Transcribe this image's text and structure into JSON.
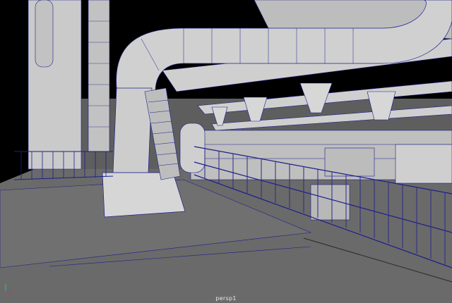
{
  "viewport": {
    "camera_label": "persp1",
    "shading": "wireframe-on-shaded",
    "colors": {
      "background": "#5e5e5e",
      "surface": "#c9c9c9",
      "wire": "#1c1f8a",
      "dark_wall": "#000000",
      "floor": "#6a6a6a"
    }
  },
  "axis_gizmo": {
    "icon": "axis-gizmo-icon",
    "colors": {
      "x": "#d23a3a",
      "y": "#3ac23a",
      "z": "#3a6ad2"
    }
  }
}
